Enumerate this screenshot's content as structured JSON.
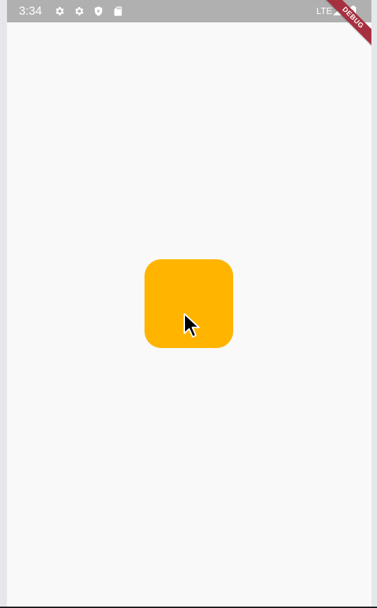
{
  "status_bar": {
    "time": "3:34",
    "left_icons": [
      "gear-icon",
      "gear-icon",
      "shield-play-icon",
      "sd-card-icon"
    ],
    "network": "LTE",
    "right_icons": [
      "signal-icon",
      "battery-icon"
    ],
    "background_color": "#b0b0b0"
  },
  "debug_banner": {
    "label": "DEBUG",
    "color": "#a6303f"
  },
  "main": {
    "background_color": "#f9f9f9",
    "box": {
      "color": "#ffb500"
    },
    "cursor": "arrow-cursor-icon"
  }
}
